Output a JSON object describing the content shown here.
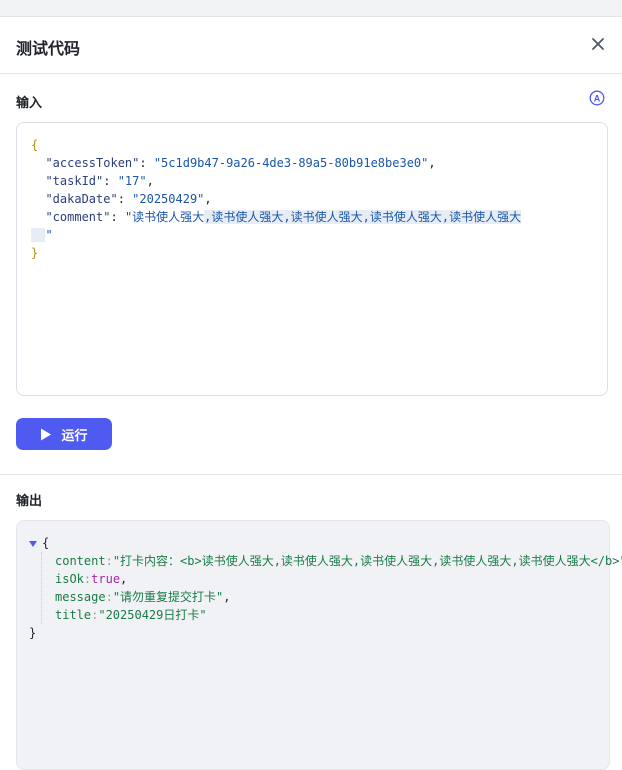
{
  "header": {
    "title": "测试代码"
  },
  "input_section": {
    "label": "输入",
    "code": {
      "open_brace": "{",
      "close_brace": "}",
      "entries": [
        {
          "key": "\"accessToken\"",
          "value": "\"5c1d9b47-9a26-4de3-89a5-80b91e8be3e0\""
        },
        {
          "key": "\"taskId\"",
          "value": "\"17\""
        },
        {
          "key": "\"dakaDate\"",
          "value": "\"20250429\""
        },
        {
          "key": "\"comment\"",
          "value_head": "\"读书使人强大",
          "value_selected": ",读书使人强大,读书使人强大,读书使人强大,读书使人强大",
          "value_tail": "\""
        }
      ]
    }
  },
  "run_button": {
    "label": "运行"
  },
  "output_section": {
    "label": "输出",
    "open_brace": "{",
    "close_brace": "}",
    "entries": [
      {
        "key": "content",
        "value": "\"打卡内容：<b>读书使人强大,读书使人强大,读书使人强大,读书使人强大,读书使人强大</b>\""
      },
      {
        "key": "isOk",
        "value": "true"
      },
      {
        "key": "message",
        "value": "\"请勿重复提交打卡\""
      },
      {
        "key": "title",
        "value": "\"20250429日打卡\""
      }
    ]
  },
  "colors": {
    "accent": "#4f5bf0",
    "json_key": "#1a7b48",
    "json_bool": "#a626a4"
  }
}
